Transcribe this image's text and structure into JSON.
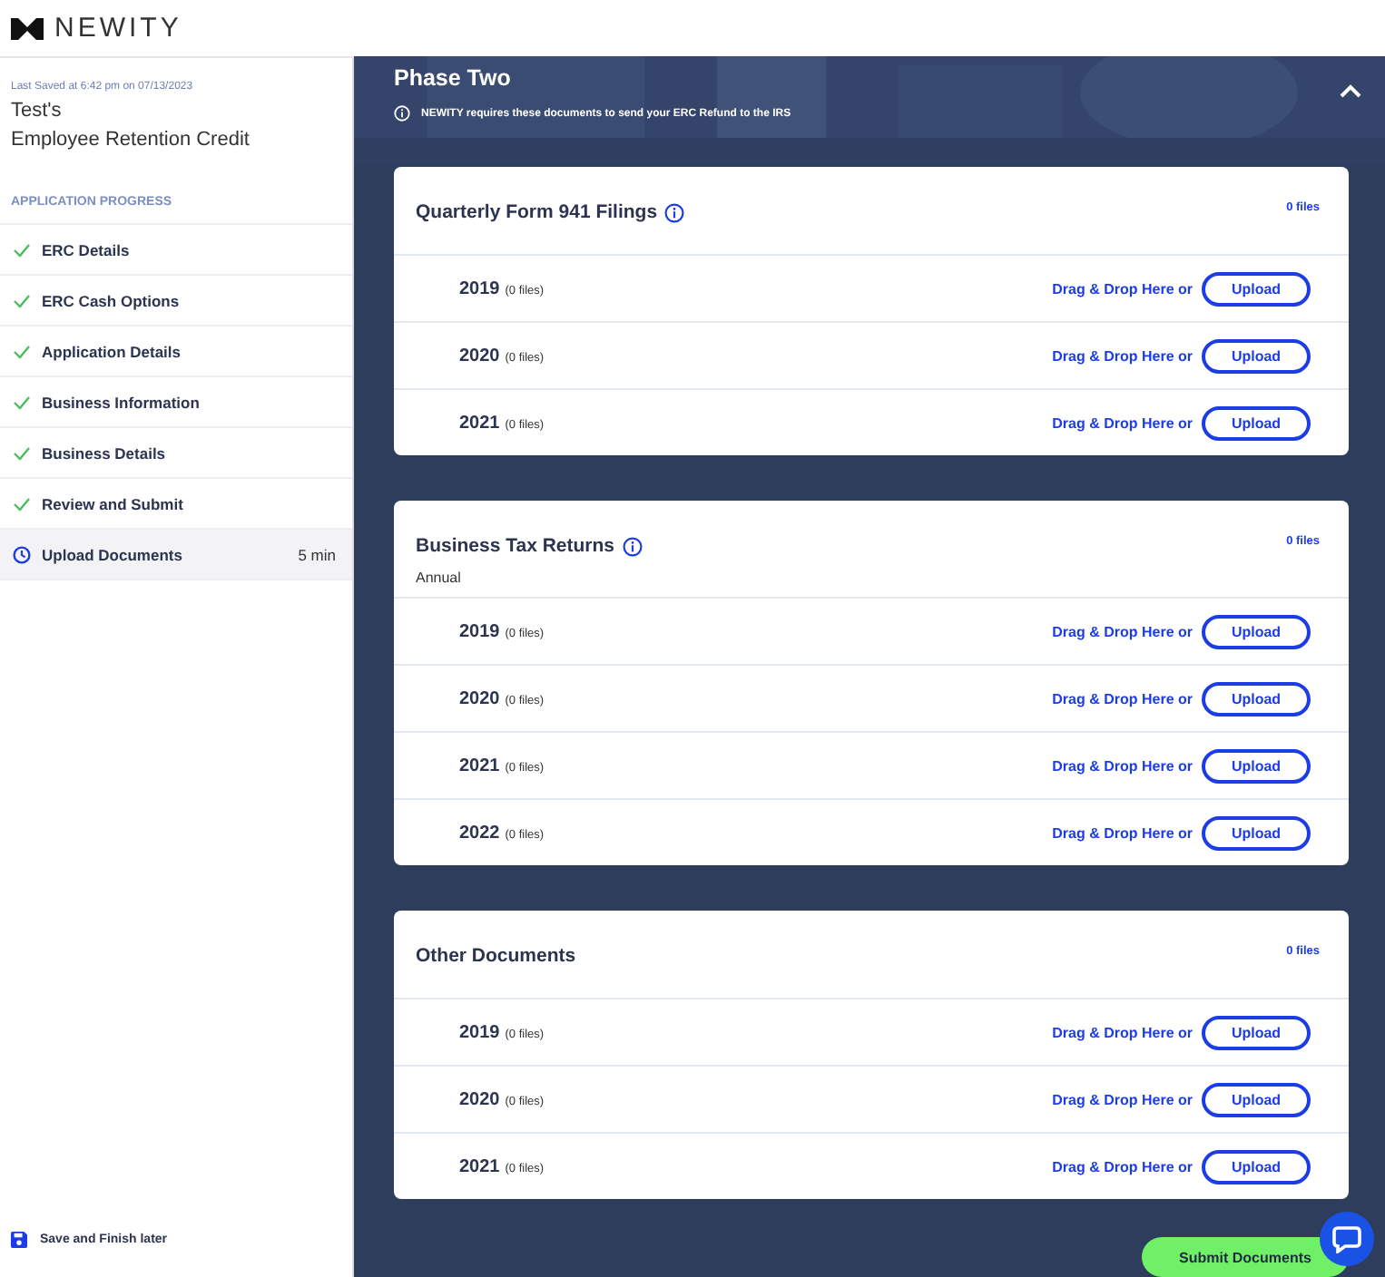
{
  "brand": {
    "name": "NEWITY"
  },
  "sidebar": {
    "last_saved": "Last Saved at 6:42 pm on 07/13/2023",
    "owner": "Test's",
    "title": "Employee Retention Credit",
    "progress_heading": "APPLICATION PROGRESS",
    "steps": [
      {
        "label": "ERC Details",
        "kind": "done",
        "selected": false
      },
      {
        "label": "ERC Cash Options",
        "kind": "done",
        "selected": false
      },
      {
        "label": "Application Details",
        "kind": "done",
        "selected": false
      },
      {
        "label": "Business Information",
        "kind": "done",
        "selected": false
      },
      {
        "label": "Business Details",
        "kind": "done",
        "selected": false
      },
      {
        "label": "Review and Submit",
        "kind": "done",
        "selected": false
      },
      {
        "label": "Upload Documents",
        "kind": "current",
        "selected": true,
        "time": "5 min"
      }
    ],
    "save_link": "Save and Finish later"
  },
  "phase": {
    "title": "Phase Two",
    "note": "NEWITY requires these documents to send your ERC Refund to the IRS",
    "expanded": true
  },
  "sections": [
    {
      "title": "Quarterly Form 941 Filings",
      "info": true,
      "count": "0 files",
      "rows": [
        {
          "year": "2019",
          "files": "(0 files)",
          "drop": "Drag & Drop Here or",
          "button": "Upload"
        },
        {
          "year": "2020",
          "files": "(0 files)",
          "drop": "Drag & Drop Here or",
          "button": "Upload"
        },
        {
          "year": "2021",
          "files": "(0 files)",
          "drop": "Drag & Drop Here or",
          "button": "Upload"
        }
      ]
    },
    {
      "title": "Business Tax Returns",
      "info": true,
      "subtitle": "Annual",
      "count": "0 files",
      "rows": [
        {
          "year": "2019",
          "files": "(0 files)",
          "drop": "Drag & Drop Here or",
          "button": "Upload"
        },
        {
          "year": "2020",
          "files": "(0 files)",
          "drop": "Drag & Drop Here or",
          "button": "Upload"
        },
        {
          "year": "2021",
          "files": "(0 files)",
          "drop": "Drag & Drop Here or",
          "button": "Upload"
        },
        {
          "year": "2022",
          "files": "(0 files)",
          "drop": "Drag & Drop Here or",
          "button": "Upload"
        }
      ]
    },
    {
      "title": "Other Documents",
      "info": false,
      "count": "0 files",
      "rows": [
        {
          "year": "2019",
          "files": "(0 files)",
          "drop": "Drag & Drop Here or",
          "button": "Upload"
        },
        {
          "year": "2020",
          "files": "(0 files)",
          "drop": "Drag & Drop Here or",
          "button": "Upload"
        },
        {
          "year": "2021",
          "files": "(0 files)",
          "drop": "Drag & Drop Here or",
          "button": "Upload"
        }
      ]
    }
  ],
  "submit_button": "Submit Documents"
}
